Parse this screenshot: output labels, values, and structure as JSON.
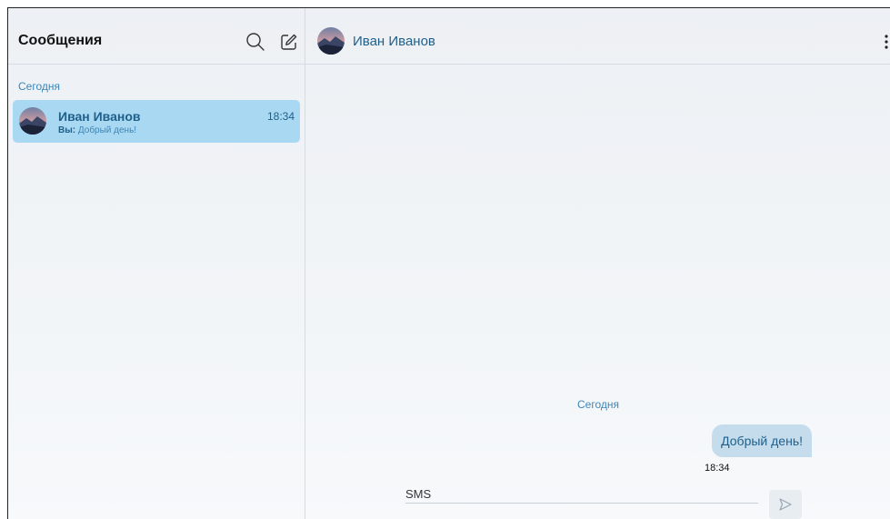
{
  "sidebar": {
    "title": "Сообщения",
    "section_label": "Сегодня",
    "chats": [
      {
        "name": "Иван Иванов",
        "preview_sender": "Вы:",
        "preview_text": "Добрый день!",
        "time": "18:34"
      }
    ]
  },
  "conversation": {
    "contact_name": "Иван Иванов",
    "date_separator": "Сегодня",
    "messages": [
      {
        "text": "Добрый день!",
        "time": "18:34",
        "outgoing": true
      }
    ],
    "input_placeholder": "SMS"
  },
  "icons": {
    "search": "search-icon",
    "compose": "compose-icon",
    "menu": "more-vertical-icon",
    "send": "send-icon"
  },
  "colors": {
    "accent": "#1f5f8a",
    "selected_chat_bg": "#a8d8f2",
    "bubble_bg": "#c4dcec"
  }
}
